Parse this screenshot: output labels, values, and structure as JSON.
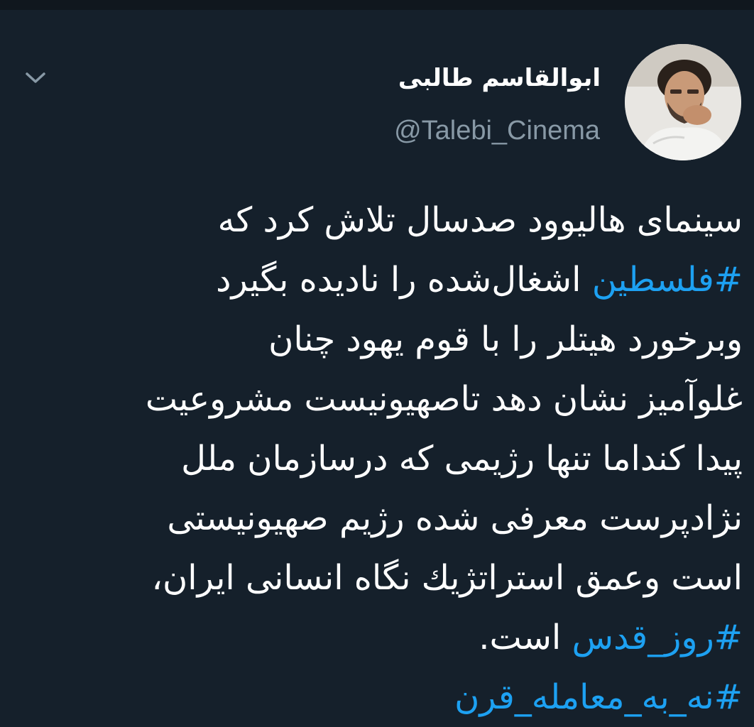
{
  "tweet": {
    "author": {
      "display_name": "ابوالقاسم طالبی",
      "handle": "@Talebi_Cinema"
    },
    "body": {
      "line1": "سینمای هالیوود صدسال تلاش کرد که",
      "line2_hashtag": "#فلسطین",
      "line2_text": " اشغال‌شده را نادیده بگیرد",
      "line3": "وبرخورد هیتلر را با قوم یهود چنان",
      "line4": "غلوآمیز نشان دهد تاصهیونیست مشروعیت",
      "line5": "پیدا کنداما تنها رژیمی که درسازمان ملل",
      "line6": "نژادپرست معرفی شده رژیم صهیونیستی",
      "line7": "است وعمق استراتژیك نگاه انسانی ایران،",
      "line8_hashtag": "#روز_قدس",
      "line8_text": " است.",
      "line9_hashtag": "#نه_به_معامله_قرن"
    }
  },
  "icons": {
    "caret": "chevron-down-icon",
    "avatar": "profile-photo"
  },
  "colors": {
    "background": "#15202b",
    "text": "#ffffff",
    "secondary": "#8899a6",
    "link": "#1da1f2"
  }
}
